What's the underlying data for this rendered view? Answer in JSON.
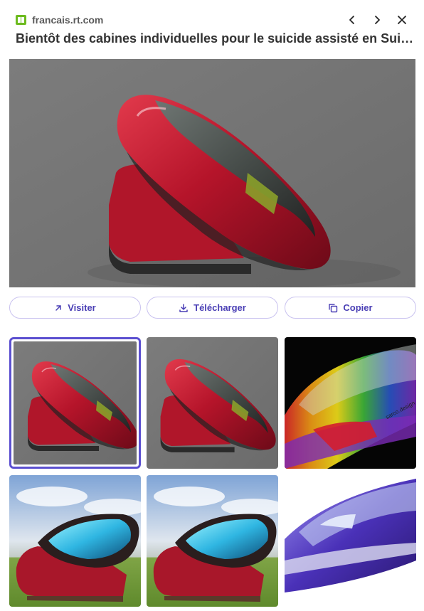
{
  "source": {
    "favicon": "rt-favicon-icon",
    "domain": "francais.rt.com",
    "accent": "#6dbb1f"
  },
  "nav": {
    "prev_icon": "chevron-left-icon",
    "next_icon": "chevron-right-icon",
    "close_icon": "close-icon"
  },
  "title": "Bientôt des cabines individuelles pour le suicide assisté en Suis...",
  "actions": {
    "visit_label": "Visiter",
    "download_label": "Télécharger",
    "copy_label": "Copier",
    "accent": "#4a3fb5"
  },
  "thumbnails": {
    "selected_index": 0,
    "items": [
      {
        "style": "studio-red"
      },
      {
        "style": "studio-red"
      },
      {
        "style": "rainbow-dark",
        "watermark": "sarco.design"
      },
      {
        "style": "field-red"
      },
      {
        "style": "field-red"
      },
      {
        "style": "purple-white"
      }
    ]
  }
}
